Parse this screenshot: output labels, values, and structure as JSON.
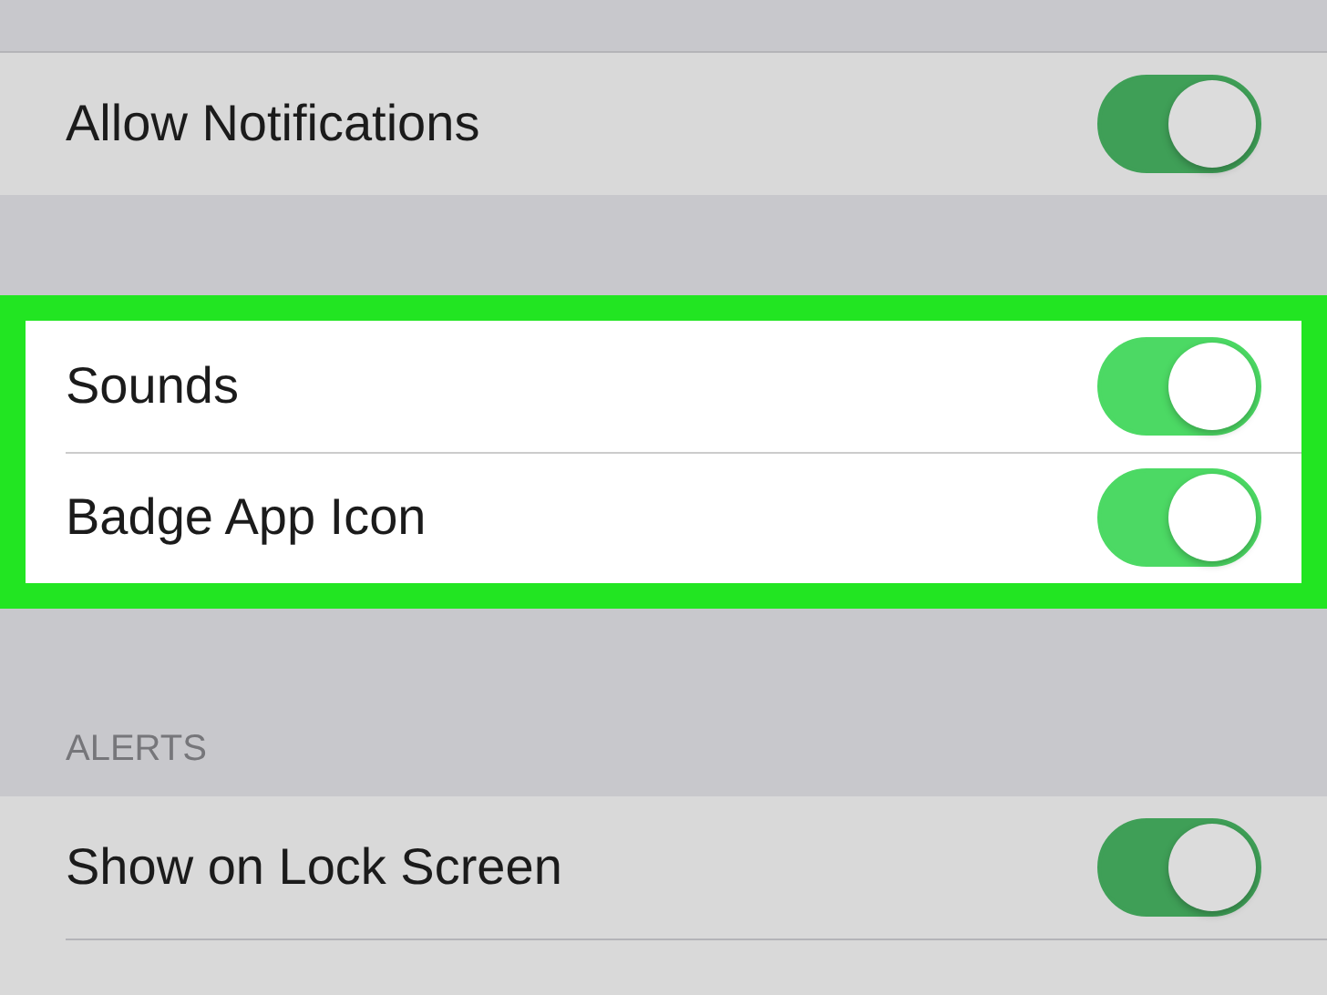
{
  "sections": [
    {
      "highlighted": false,
      "rows": [
        {
          "label": "Allow Notifications",
          "on": true
        }
      ]
    },
    {
      "highlighted": true,
      "rows": [
        {
          "label": "Sounds",
          "on": true
        },
        {
          "label": "Badge App Icon",
          "on": true
        }
      ]
    },
    {
      "highlighted": false,
      "header": "ALERTS",
      "rows": [
        {
          "label": "Show on Lock Screen",
          "on": true
        }
      ]
    }
  ]
}
